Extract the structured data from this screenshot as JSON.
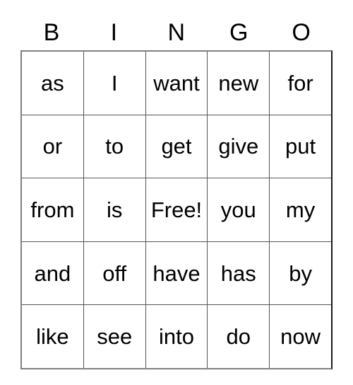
{
  "card": {
    "headers": [
      "B",
      "I",
      "N",
      "G",
      "O"
    ],
    "rows": [
      [
        "as",
        "I",
        "want",
        "new",
        "for"
      ],
      [
        "or",
        "to",
        "get",
        "give",
        "put"
      ],
      [
        "from",
        "is",
        "Free!",
        "you",
        "my"
      ],
      [
        "and",
        "off",
        "have",
        "has",
        "by"
      ],
      [
        "like",
        "see",
        "into",
        "do",
        "now"
      ]
    ],
    "free_space": {
      "row": 2,
      "col": 2,
      "label": "Free!"
    },
    "colors": {
      "background": "#ffffff",
      "text": "#000000",
      "grid_line": "#555555",
      "outer_border": "#808080"
    }
  }
}
